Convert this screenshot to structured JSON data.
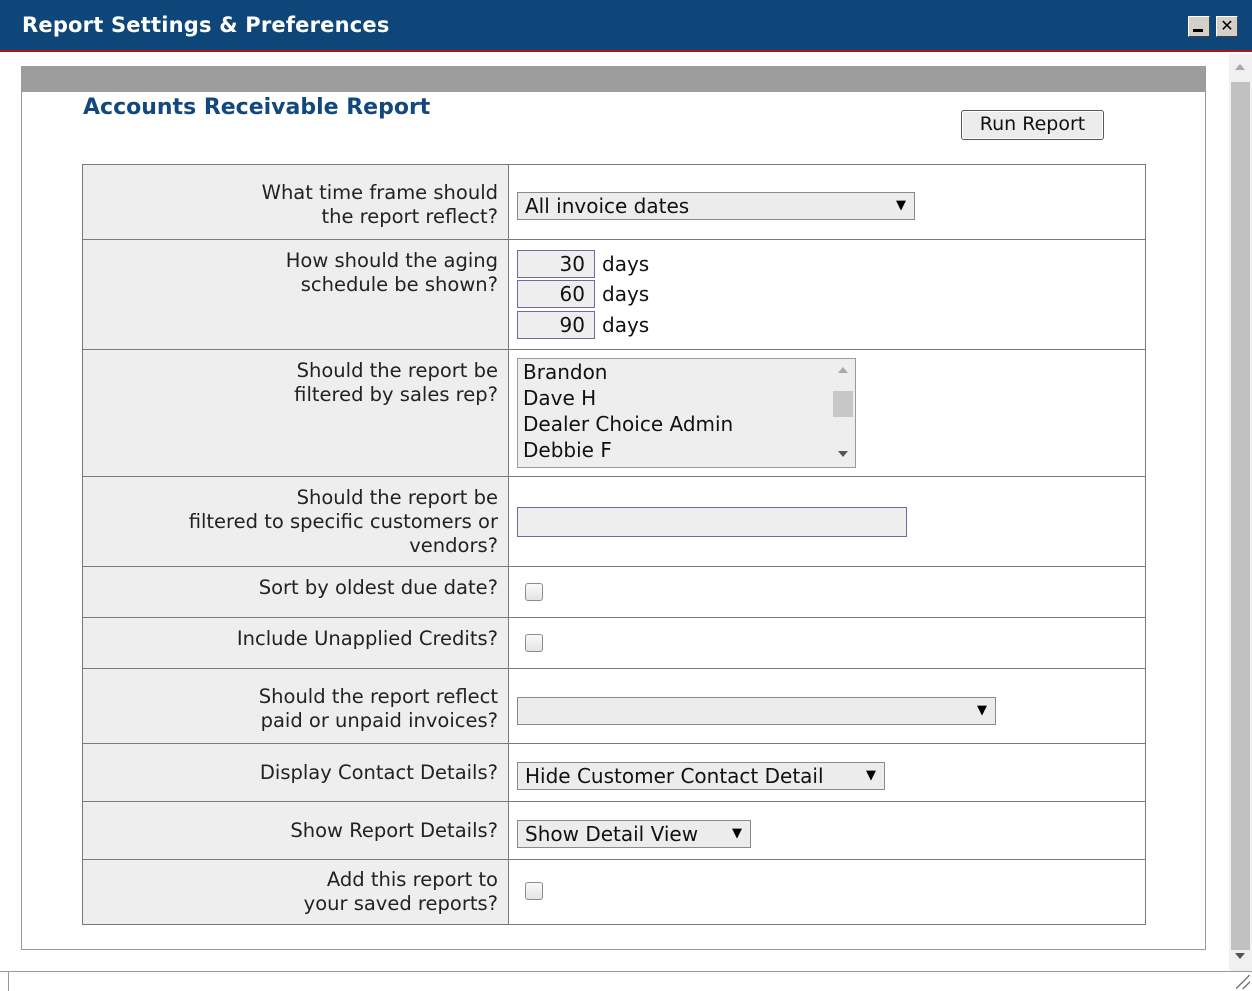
{
  "window": {
    "title": "Report Settings & Preferences",
    "minimize_icon": "minimize-icon",
    "close_icon": "close-icon",
    "close_glyph": "✕"
  },
  "report": {
    "title": "Accounts Receivable Report",
    "run_button": "Run Report"
  },
  "rows": {
    "time_frame": {
      "question_line1": "What time frame should",
      "question_line2": "the report reflect?",
      "selected": "All invoice dates"
    },
    "aging": {
      "question_line1": "How should the aging",
      "question_line2": "schedule be shown?",
      "buckets": [
        {
          "value": "30",
          "unit": "days"
        },
        {
          "value": "60",
          "unit": "days"
        },
        {
          "value": "90",
          "unit": "days"
        }
      ]
    },
    "sales_rep": {
      "question_line1": "Should the report be",
      "question_line2": "filtered by sales rep?",
      "options": [
        "Brandon",
        "Dave H",
        "Dealer Choice Admin",
        "Debbie F"
      ]
    },
    "customers": {
      "question_line1": "Should the report be",
      "question_line2": "filtered to specific customers or",
      "question_line3": "vendors?",
      "value": ""
    },
    "sort_oldest": {
      "question": "Sort by oldest due date?",
      "checked": false
    },
    "unapplied_credits": {
      "question": "Include Unapplied Credits?",
      "checked": false
    },
    "paid_unpaid": {
      "question_line1": "Should the report reflect",
      "question_line2": "paid or unpaid invoices?",
      "selected": ""
    },
    "contact_details": {
      "question": "Display Contact Details?",
      "selected": "Hide Customer Contact Detail"
    },
    "report_details": {
      "question": "Show Report Details?",
      "selected": "Show Detail View"
    },
    "save_report": {
      "question_line1": "Add this report to",
      "question_line2": "your saved reports?",
      "checked": false
    }
  },
  "dropdown_arrow": "▼",
  "colors": {
    "titlebar": "#0e4679",
    "title_accent": "#13487e",
    "question_bg": "#eeeeee"
  }
}
